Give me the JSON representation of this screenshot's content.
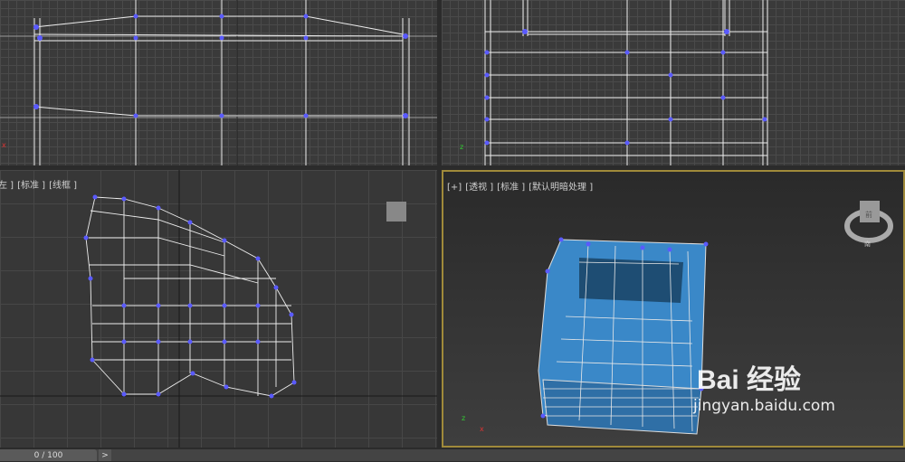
{
  "viewports": {
    "left": {
      "labels": [
        "左 ]",
        "[标准 ]",
        "[线框 ]"
      ]
    },
    "perspective": {
      "labels": [
        "[+]",
        "[透视 ]",
        "[标准 ]",
        "[默认明暗处理 ]"
      ]
    }
  },
  "viewcube": {
    "face": "前",
    "compass": "南"
  },
  "timeline": {
    "frame": "0 / 100",
    "next_label": ">"
  },
  "watermark": {
    "brand": "Bai 经验",
    "url": "jingyan.baidu.com"
  },
  "colors": {
    "vertex": "#5a5aff",
    "active_border": "#a08a3a",
    "mesh_fill": "#3a88c8"
  }
}
